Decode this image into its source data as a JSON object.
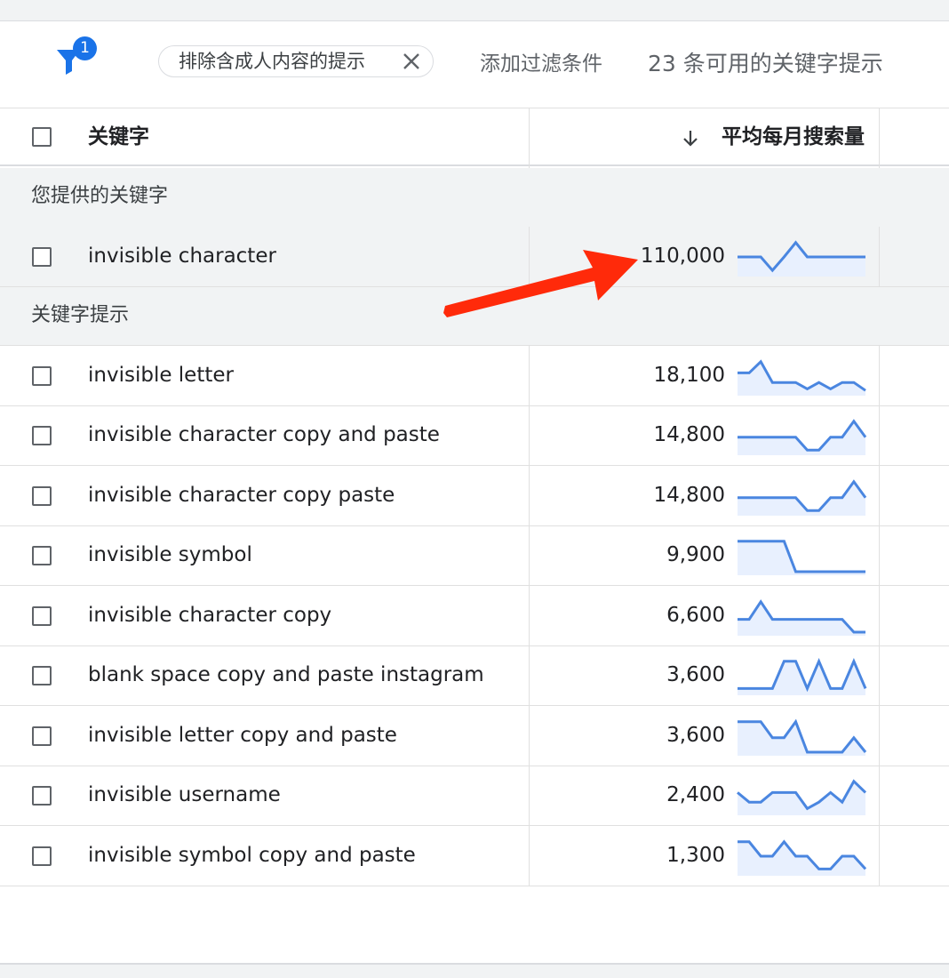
{
  "colors": {
    "accent": "#1a73e8",
    "spark_line": "#4a86e0",
    "spark_fill": "#e8f0fe",
    "annotation": "#ff2a0a"
  },
  "filter_bar": {
    "filter_icon": "filter-icon",
    "filter_count": "1",
    "chip_label": "排除含成人内容的提示",
    "chip_close_icon": "close-icon",
    "add_filter_label": "添加过滤条件",
    "result_count": "23 条可用的关键字提示"
  },
  "table": {
    "columns": {
      "keyword": "关键字",
      "avg_monthly_searches": "平均每月搜索量",
      "sort_icon": "arrow-down-icon"
    },
    "provided_section_label": "您提供的关键字",
    "provided_rows": [
      {
        "keyword": "invisible character",
        "volume": "110,000",
        "trend": [
          0.5,
          0.5,
          0.5,
          0.08,
          0.5,
          0.95,
          0.5,
          0.5,
          0.5,
          0.5,
          0.5,
          0.5
        ]
      }
    ],
    "ideas_section_label": "关键字提示",
    "idea_rows": [
      {
        "keyword": "invisible letter",
        "volume": "18,100",
        "trend": [
          0.6,
          0.6,
          0.95,
          0.3,
          0.3,
          0.3,
          0.1,
          0.3,
          0.1,
          0.3,
          0.3,
          0.05
        ]
      },
      {
        "keyword": "invisible character copy and paste",
        "volume": "14,800",
        "trend": [
          0.45,
          0.45,
          0.45,
          0.45,
          0.45,
          0.45,
          0.05,
          0.05,
          0.45,
          0.45,
          0.95,
          0.45
        ]
      },
      {
        "keyword": "invisible character copy paste",
        "volume": "14,800",
        "trend": [
          0.45,
          0.45,
          0.45,
          0.45,
          0.45,
          0.45,
          0.05,
          0.05,
          0.45,
          0.45,
          0.95,
          0.45
        ]
      },
      {
        "keyword": "invisible symbol",
        "volume": "9,900",
        "trend": [
          0.95,
          0.95,
          0.95,
          0.95,
          0.95,
          0.0,
          0.0,
          0.0,
          0.0,
          0.0,
          0.0,
          0.0
        ]
      },
      {
        "keyword": "invisible character copy",
        "volume": "6,600",
        "trend": [
          0.4,
          0.4,
          0.95,
          0.4,
          0.4,
          0.4,
          0.4,
          0.4,
          0.4,
          0.4,
          0.0,
          0.0
        ]
      },
      {
        "keyword": "blank space copy and paste instagram",
        "volume": "3,600",
        "trend": [
          0.1,
          0.1,
          0.1,
          0.1,
          0.95,
          0.95,
          0.1,
          0.95,
          0.1,
          0.1,
          0.95,
          0.1
        ]
      },
      {
        "keyword": "invisible letter copy and paste",
        "volume": "3,600",
        "trend": [
          0.95,
          0.95,
          0.95,
          0.45,
          0.45,
          0.95,
          0.0,
          0.0,
          0.0,
          0.0,
          0.45,
          0.0
        ]
      },
      {
        "keyword": "invisible username",
        "volume": "2,400",
        "trend": [
          0.6,
          0.3,
          0.3,
          0.6,
          0.6,
          0.6,
          0.1,
          0.3,
          0.6,
          0.3,
          0.95,
          0.6
        ]
      },
      {
        "keyword": "invisible symbol copy and paste",
        "volume": "1,300",
        "trend": [
          0.95,
          0.95,
          0.5,
          0.5,
          0.95,
          0.5,
          0.5,
          0.1,
          0.1,
          0.5,
          0.5,
          0.1
        ]
      }
    ]
  }
}
